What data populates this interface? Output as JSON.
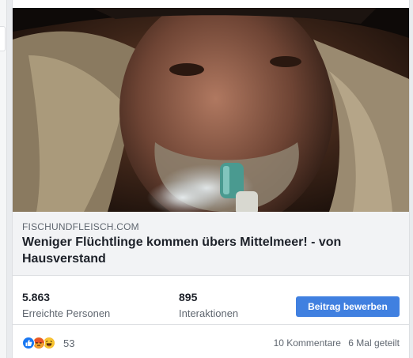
{
  "link_preview": {
    "domain": "FISCHUNDFLEISCH.COM",
    "title": "Weniger Flüchtlinge kommen übers Mittelmeer! - von Hausverstand"
  },
  "stats": {
    "reach": {
      "value": "5.863",
      "label": "Erreichte Personen"
    },
    "engagement": {
      "value": "895",
      "label": "Interaktionen"
    }
  },
  "promote_button": {
    "label": "Beitrag bewerben",
    "color": "#4080e0"
  },
  "reactions": {
    "icons": [
      "like-icon",
      "angry-icon",
      "haha-icon"
    ],
    "count": "53"
  },
  "footer": {
    "comments": "10 Kommentare",
    "shares": "6 Mal geteilt"
  }
}
